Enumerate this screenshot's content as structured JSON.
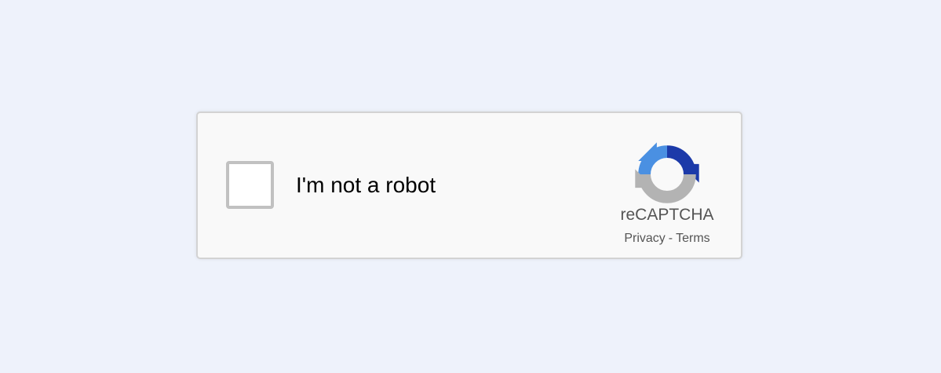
{
  "recaptcha": {
    "checkbox_label": "I'm not a robot",
    "checked": false,
    "brand_name": "reCAPTCHA",
    "logo_icon": "recaptcha-logo-icon",
    "privacy_link": "Privacy",
    "separator": "-",
    "terms_link": "Terms",
    "colors": {
      "page_background": "#eef2fb",
      "widget_background": "#f9f9f9",
      "widget_border": "#d3d3d3",
      "checkbox_border": "#c1c1c1",
      "logo_dark_blue": "#1c3aa9",
      "logo_light_blue": "#4a90e2",
      "logo_gray": "#b3b3b3",
      "muted_text": "#555555"
    }
  }
}
